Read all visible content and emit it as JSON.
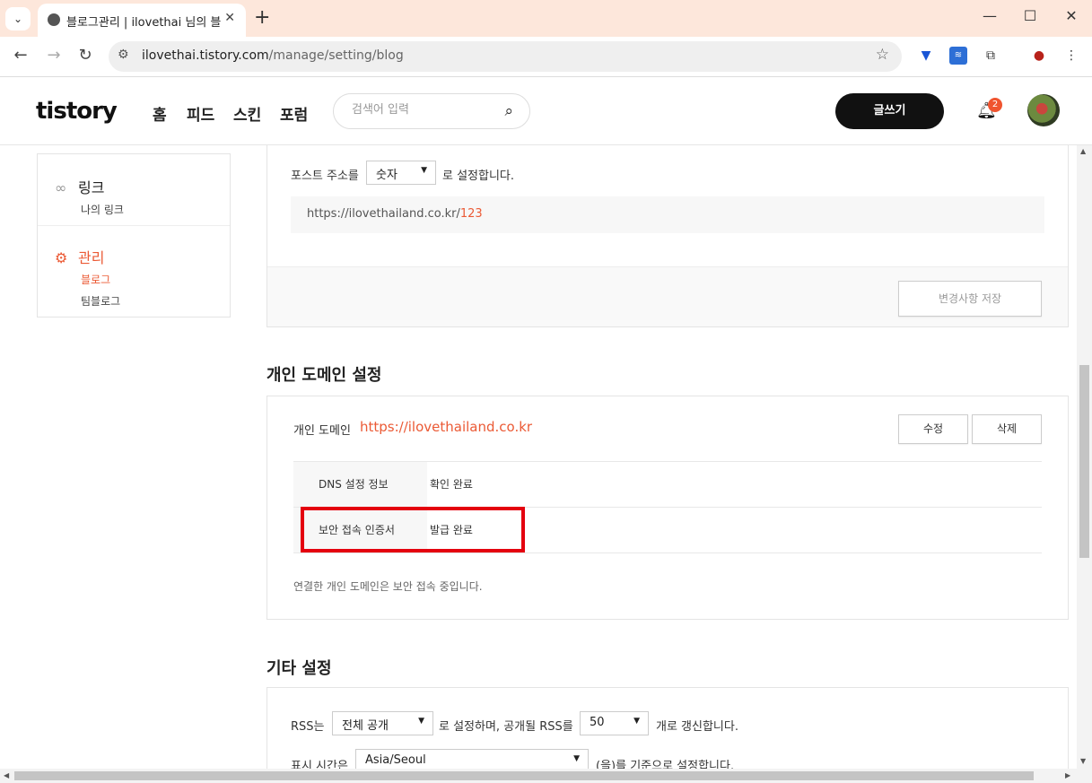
{
  "browser": {
    "tab_title": "블로그관리 | ilovethai 님의 블로그",
    "url_host": "ilovethai.tistory.com",
    "url_path": "/manage/setting/blog"
  },
  "header": {
    "logo": "tistory",
    "nav": [
      "홈",
      "피드",
      "스킨",
      "포럼"
    ],
    "search_placeholder": "검색어 입력",
    "write_button": "글쓰기",
    "notification_count": "2"
  },
  "sidebar": {
    "link_group": {
      "title": "링크",
      "items": [
        "나의 링크"
      ]
    },
    "manage_group": {
      "title": "관리",
      "items": [
        "블로그",
        "팀블로그"
      ]
    }
  },
  "post_address": {
    "label_prefix": "포스트 주소를",
    "selected": "숫자",
    "label_suffix": "로 설정합니다.",
    "example_base": "https://ilovethailand.co.kr/",
    "example_id": "123",
    "save_button": "변경사항 저장"
  },
  "domain": {
    "section_title": "개인 도메인 설정",
    "label": "개인 도메인",
    "value": "https://ilovethailand.co.kr",
    "edit_button": "수정",
    "delete_button": "삭제",
    "rows": [
      {
        "key": "DNS 설정 정보",
        "value": "확인 완료"
      },
      {
        "key": "보안 접속 인증서",
        "value": "발급 완료"
      }
    ],
    "note": "연결한 개인 도메인은 보안 접속 중입니다."
  },
  "other": {
    "section_title": "기타 설정",
    "rss_prefix": "RSS는",
    "rss_selected": "전체 공개",
    "rss_middle": "로 설정하며, 공개될 RSS를",
    "rss_count": "50",
    "rss_suffix": "개로 갱신합니다.",
    "time_prefix": "표시 시간은",
    "time_selected": "Asia/Seoul",
    "time_suffix": "(을)를 기준으로 설정합니다."
  },
  "colors": {
    "accent": "#eb5a35",
    "highlight_box": "#e4000f",
    "chrome_tabbar": "#fde7db"
  }
}
